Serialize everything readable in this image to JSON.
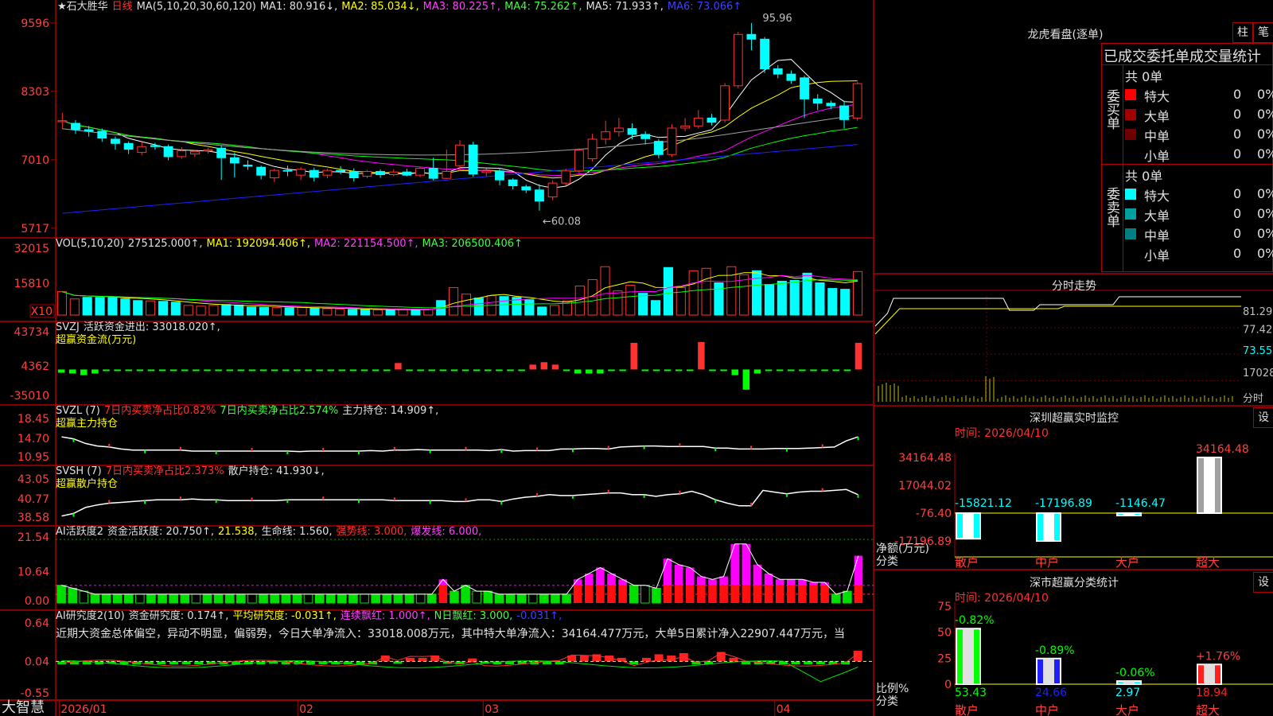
{
  "app": {
    "brand": "大智慧",
    "stock_name": "★石大胜华",
    "period": "日线"
  },
  "colors": {
    "bg": "#000000",
    "frame": "#b00000",
    "up": "#ff3232",
    "down": "#00ffff",
    "ma1": "#ffffff",
    "ma2": "#ffff00",
    "ma3": "#ff00ff",
    "ma4": "#00ff00",
    "ma5": "#a0a0a0",
    "ma6": "#2020ff"
  },
  "x_axis": {
    "labels": [
      {
        "text": "2026/01",
        "i": 0
      },
      {
        "text": "02",
        "i": 18
      },
      {
        "text": "03",
        "i": 32
      },
      {
        "text": "04",
        "i": 54
      }
    ]
  },
  "main_header": {
    "ma_label": "MA(5,10,20,30,60,120)",
    "ma1": "MA1: 80.916↓,",
    "ma2": "MA2: 85.034↓,",
    "ma3": "MA3: 80.225↑,",
    "ma4": "MA4: 75.262↑,",
    "ma5": "MA5: 71.933↑,",
    "ma6": "MA6: 73.066↑"
  },
  "chart_data": [
    {
      "type": "candlestick",
      "title": "石大胜华 日线",
      "yticks": [
        "95.96",
        "83.03",
        "70.10",
        "57.17"
      ],
      "ylim": [
        56.4,
        97.0
      ],
      "annotations": {
        "high": "95.96",
        "low": "←60.08"
      },
      "candles": [
        [
          77.3,
          77.5,
          79.0,
          76.0
        ],
        [
          77.0,
          75.8,
          77.6,
          75.0
        ],
        [
          75.8,
          75.5,
          76.5,
          74.5
        ],
        [
          75.5,
          74.2,
          76.0,
          73.5
        ],
        [
          74.0,
          73.2,
          74.5,
          72.0
        ],
        [
          73.2,
          72.1,
          73.6,
          71.2
        ],
        [
          71.5,
          72.6,
          73.5,
          71.0
        ],
        [
          72.8,
          72.6,
          73.3,
          72.0
        ],
        [
          72.6,
          70.7,
          73.0,
          70.0
        ],
        [
          70.7,
          71.8,
          72.5,
          70.3
        ],
        [
          71.2,
          71.7,
          72.0,
          70.7
        ],
        [
          71.8,
          72.0,
          72.3,
          71.3
        ],
        [
          72.3,
          70.5,
          72.8,
          66.3
        ],
        [
          70.5,
          69.5,
          71.5,
          66.8
        ],
        [
          69.1,
          68.9,
          70.0,
          68.2
        ],
        [
          68.7,
          67.2,
          69.0,
          66.4
        ],
        [
          66.7,
          68.1,
          68.4,
          65.9
        ],
        [
          68.1,
          68.0,
          69.0,
          67.0
        ],
        [
          67.2,
          68.3,
          68.7,
          66.3
        ],
        [
          68.1,
          66.8,
          68.6,
          66.0
        ],
        [
          67.2,
          68.1,
          68.4,
          66.6
        ],
        [
          68.1,
          67.9,
          68.9,
          67.4
        ],
        [
          67.9,
          66.7,
          68.5,
          66.0
        ],
        [
          67.0,
          67.9,
          68.2,
          66.6
        ],
        [
          67.9,
          67.3,
          68.3,
          66.7
        ],
        [
          67.3,
          67.8,
          68.3,
          67.0
        ],
        [
          67.8,
          67.2,
          68.4,
          67.0
        ],
        [
          67.2,
          68.5,
          68.8,
          66.8
        ],
        [
          68.5,
          66.6,
          70.5,
          66.2
        ],
        [
          66.6,
          67.9,
          72.0,
          66.5
        ],
        [
          69.0,
          72.9,
          73.8,
          68.0
        ],
        [
          72.9,
          67.4,
          73.5,
          66.9
        ],
        [
          67.7,
          68.0,
          68.5,
          67.0
        ],
        [
          68.0,
          66.3,
          68.6,
          65.3
        ],
        [
          66.3,
          65.2,
          66.6,
          64.5
        ],
        [
          65.0,
          64.4,
          65.4,
          63.8
        ],
        [
          64.4,
          62.3,
          65.5,
          60.5
        ],
        [
          63.1,
          65.7,
          66.2,
          62.5
        ],
        [
          65.7,
          68.0,
          68.4,
          65.3
        ],
        [
          68.0,
          71.9,
          72.3,
          67.6
        ],
        [
          70.3,
          74.0,
          75.0,
          69.8
        ],
        [
          74.0,
          75.4,
          77.5,
          73.0
        ],
        [
          75.4,
          76.1,
          78.0,
          74.5
        ],
        [
          76.0,
          74.9,
          77.0,
          74.0
        ],
        [
          74.9,
          74.1,
          75.5,
          73.0
        ],
        [
          73.6,
          71.1,
          74.0,
          70.4
        ],
        [
          71.1,
          76.1,
          76.8,
          70.7
        ],
        [
          76.1,
          76.5,
          78.0,
          75.5
        ],
        [
          76.5,
          78.0,
          79.5,
          76.0
        ],
        [
          78.0,
          77.2,
          78.8,
          76.6
        ],
        [
          77.6,
          84.1,
          84.6,
          77.2
        ],
        [
          84.1,
          93.8,
          94.3,
          83.6
        ],
        [
          93.8,
          92.9,
          95.96,
          90.8
        ],
        [
          92.9,
          87.3,
          93.3,
          86.5
        ],
        [
          87.3,
          86.3,
          88.0,
          85.5
        ],
        [
          86.3,
          85.1,
          87.0,
          84.5
        ],
        [
          85.6,
          81.6,
          86.0,
          78.0
        ],
        [
          81.6,
          80.8,
          82.5,
          79.5
        ],
        [
          80.8,
          80.3,
          81.3,
          79.7
        ],
        [
          80.3,
          77.7,
          81.3,
          76.0
        ],
        [
          78.0,
          84.5,
          84.8,
          77.5
        ]
      ]
    },
    {
      "type": "bar",
      "title": "VOL(5,10,20)",
      "yticks": [
        "32015",
        "15810",
        "X10"
      ],
      "ylim": [
        0,
        40000
      ],
      "values": [
        14500,
        10000,
        11000,
        11000,
        11000,
        10000,
        9000,
        8800,
        8500,
        8000,
        6000,
        5500,
        6000,
        6500,
        6200,
        5000,
        4800,
        4600,
        4500,
        4800,
        4300,
        4000,
        3600,
        3500,
        3400,
        3200,
        3200,
        3800,
        3100,
        3600,
        9000,
        17000,
        13000,
        10500,
        12000,
        11500,
        11000,
        9500,
        5000,
        6000,
        8800,
        18000,
        22000,
        30000,
        15000,
        18500,
        13500,
        9000,
        29500,
        17000,
        27500,
        29000,
        20000,
        30000,
        25000,
        27500,
        19000,
        21000,
        21500,
        26000,
        20000,
        16500,
        16000,
        27000
      ],
      "label_vol": "275125.000↑,",
      "ma1": "MA1: 192094.406↑,",
      "ma2": "MA2: 221154.500↑,",
      "ma3": "MA3: 206500.406↑"
    },
    {
      "type": "bar",
      "title": "SVZJ",
      "yticks": [
        "43734",
        "4362",
        "-35010"
      ],
      "ylim": [
        -35010,
        43734
      ],
      "values": [
        -4000,
        -5000,
        -7000,
        -5000,
        -500,
        -600,
        -700,
        -800,
        -1000,
        -600,
        -500,
        -500,
        -800,
        -700,
        -700,
        -600,
        -600,
        -500,
        -400,
        -600,
        -500,
        -500,
        -500,
        -400,
        -500,
        -400,
        -500,
        -800,
        -400,
        -700,
        8000,
        -400,
        -500,
        -500,
        -500,
        -500,
        -600,
        -700,
        -600,
        -500,
        -500,
        -400,
        6000,
        9000,
        6000,
        -500,
        -5000,
        -5000,
        -5000,
        -500,
        -500,
        33000,
        -500,
        -500,
        -500,
        -500,
        -500,
        34000,
        -500,
        -500,
        -7000,
        -25000,
        -5000,
        -500,
        -500,
        -500,
        -500,
        -500,
        -500,
        -500,
        -500,
        33018
      ],
      "label": "活跃资金进出: 33018.020↑,",
      "sublabel": "超赢资金流(万元)"
    },
    {
      "type": "line",
      "title": "SVZL (7)",
      "yticks": [
        "18.45",
        "14.70",
        "10.95"
      ],
      "ylim": [
        10.95,
        18.45
      ],
      "values": [
        15.0,
        14.6,
        13.7,
        13.2,
        13.0,
        12.6,
        12.4,
        12.4,
        12.4,
        12.4,
        12.4,
        12.2,
        12.2,
        12.2,
        12.2,
        12.2,
        12.2,
        12.2,
        12.2,
        12.2,
        12.1,
        12.2,
        12.2,
        12.2,
        12.2,
        12.2,
        12.3,
        12.2,
        12.4,
        12.4,
        12.5,
        12.4,
        12.4,
        12.4,
        12.4,
        12.4,
        12.3,
        12.5,
        12.2,
        12.3,
        12.3,
        12.3,
        12.6,
        12.6,
        12.7,
        12.7,
        12.6,
        13.0,
        13.1,
        13.2,
        13.2,
        13.1,
        13.1,
        13.1,
        13.1,
        12.8,
        12.8,
        12.6,
        12.6,
        12.6,
        12.7,
        12.7,
        12.7,
        12.8,
        12.9,
        13.0,
        14.2,
        15.0
      ],
      "label1": "7日内买卖净占比0.82%",
      "label2": "7日内买卖净占比2.574%",
      "label3": "主力持仓: 14.909↑,",
      "sublabel": "超赢主力持仓"
    },
    {
      "type": "line",
      "title": "SVSH (7)",
      "yticks": [
        "43.05",
        "40.77",
        "38.58"
      ],
      "ylim": [
        38.58,
        43.05
      ],
      "values": [
        38.8,
        39.1,
        39.8,
        40.1,
        40.3,
        40.4,
        40.5,
        40.6,
        40.7,
        40.7,
        40.7,
        40.8,
        40.7,
        40.7,
        40.6,
        40.6,
        40.6,
        40.6,
        40.6,
        40.7,
        40.7,
        40.7,
        40.7,
        40.7,
        40.7,
        40.7,
        40.7,
        40.7,
        40.6,
        40.6,
        40.6,
        40.6,
        40.6,
        40.5,
        40.5,
        40.7,
        40.7,
        40.5,
        40.8,
        41.0,
        41.1,
        41.3,
        41.2,
        41.2,
        41.3,
        41.4,
        41.5,
        41.5,
        41.3,
        41.3,
        41.1,
        41.3,
        41.4,
        41.7,
        41.3,
        40.7,
        40.3,
        40.0,
        40.0,
        41.8,
        41.6,
        41.4,
        41.6,
        41.7,
        41.7,
        41.8,
        41.9,
        41.3
      ],
      "label1": "7日内买卖净占比2.373%",
      "label2": "散户持仓: 41.930↓,",
      "sublabel": "超赢散户持仓"
    },
    {
      "type": "bar",
      "title": "AI活跃度2",
      "yticks": [
        "21.54",
        "10.64",
        "0.00"
      ],
      "ylim": [
        0,
        21.54
      ],
      "values": [
        6,
        5,
        4,
        3,
        3,
        3,
        3,
        3,
        3,
        3,
        3,
        3,
        3,
        3,
        3,
        3,
        3,
        3,
        3,
        3,
        3,
        3,
        3,
        3,
        3,
        3,
        3,
        3,
        3,
        3,
        3,
        3,
        3,
        3,
        8,
        4,
        6,
        4,
        4,
        3,
        3,
        3,
        3,
        3,
        3,
        3,
        8,
        10,
        12,
        10,
        8,
        6,
        6,
        5,
        15,
        13,
        12,
        9,
        8,
        9,
        20,
        20,
        13,
        10,
        8,
        8,
        8,
        7,
        7,
        3,
        4,
        16
      ],
      "label1": "资金活跃度: 20.750↑,",
      "label2": "21.538,",
      "label3": "生命线: 1.560,",
      "label4": "强势线: 3.000,",
      "label5": "爆发线: 6.000,"
    },
    {
      "type": "bar",
      "title": "AI研究度2(10)",
      "yticks": [
        "0.64",
        "0.04",
        "-0.55"
      ],
      "ylim": [
        -0.55,
        0.64
      ],
      "values": [
        -0.05,
        -0.05,
        -0.05,
        -0.05,
        -0.04,
        -0.05,
        -0.05,
        -0.05,
        -0.05,
        -0.05,
        -0.05,
        -0.05,
        -0.05,
        -0.05,
        -0.05,
        -0.05,
        -0.05,
        -0.04,
        -0.05,
        -0.05,
        -0.05,
        -0.05,
        -0.05,
        -0.05,
        -0.05,
        -0.05,
        0.1,
        -0.04,
        0.06,
        0.06,
        0.1,
        -0.04,
        -0.05,
        0.05,
        -0.04,
        -0.05,
        -0.05,
        -0.05,
        -0.05,
        -0.05,
        -0.05,
        0.1,
        0.1,
        0.12,
        0.1,
        0.06,
        -0.05,
        0.06,
        0.12,
        0.1,
        0.14,
        -0.05,
        -0.05,
        0.16,
        0.06,
        -0.05,
        -0.05,
        -0.05,
        -0.05,
        -0.05,
        -0.05,
        -0.05,
        -0.05,
        -0.05,
        0.18
      ],
      "label1": "资金研究度: 0.174↑,",
      "label2": "平均研究度: -0.031↑,",
      "label3": "连续飘红: 1.000↑,",
      "label4": "N日飘红: 3.000,",
      "label5": "-0.031↑,",
      "note": "近期大资金总体偏空，异动不明显，偏弱势，今日大单净流入：33018.008万元，其中特大单净流入：34164.477万元，大单5日累计净入22907.447万元，当"
    },
    {
      "type": "bar",
      "title": "深圳超赢实时监控",
      "categories": [
        "散户",
        "中户",
        "大户",
        "超大"
      ],
      "values": [
        -15821.12,
        -17196.89,
        -1146.47,
        34164.48
      ],
      "yticks": [
        "34164.48",
        "17044.02",
        "-76.40",
        "-17196.89"
      ],
      "ylim": [
        -17196.89,
        34164.48
      ],
      "ylabel": "净额(万元)",
      "xlabel": "分类"
    },
    {
      "type": "bar",
      "title": "深市超赢分类统计",
      "categories": [
        "散户",
        "中户",
        "大户",
        "超大"
      ],
      "values": [
        53.43,
        24.66,
        2.97,
        18.94
      ],
      "changes": [
        "-0.82%",
        "-0.89%",
        "-0.06%",
        "+1.76%"
      ],
      "yticks": [
        "75",
        "50",
        "25",
        "0"
      ],
      "ylim": [
        0,
        75
      ],
      "ylabel": "比例%",
      "xlabel": "分类"
    }
  ],
  "right_panel": {
    "dragon_title": "龙虎看盘(逐单)",
    "btn1": "柱",
    "btn2": "笔",
    "table_title": "已成交委托单成交量统计",
    "buy_side_label": "委买单",
    "sell_side_label": "委卖单",
    "buy_total": "共 0单",
    "sell_total": "共 0单",
    "buy_rows": [
      {
        "label": "特大",
        "n": "0",
        "p": "0%",
        "color": "#ff0000"
      },
      {
        "label": "大单",
        "n": "0",
        "p": "0%",
        "color": "#a00000"
      },
      {
        "label": "中单",
        "n": "0",
        "p": "0%",
        "color": "#700000"
      },
      {
        "label": "小单",
        "n": "0",
        "p": "0%",
        "color": "#000000"
      }
    ],
    "sell_rows": [
      {
        "label": "特大",
        "n": "0",
        "p": "0%",
        "color": "#00ffff"
      },
      {
        "label": "大单",
        "n": "0",
        "p": "0%",
        "color": "#00a0a0"
      },
      {
        "label": "中单",
        "n": "0",
        "p": "0%",
        "color": "#008080"
      },
      {
        "label": "小单",
        "n": "0",
        "p": "0%",
        "color": "#000000"
      }
    ],
    "intraday_title": "分时走势",
    "intraday_ticks": [
      "81.29",
      "77.42",
      "73.55",
      "17028",
      "分时"
    ],
    "monitor_date": "时间: 2026/04/10",
    "set_btn": "设",
    "stats_date": "时间: 2026/04/10"
  }
}
